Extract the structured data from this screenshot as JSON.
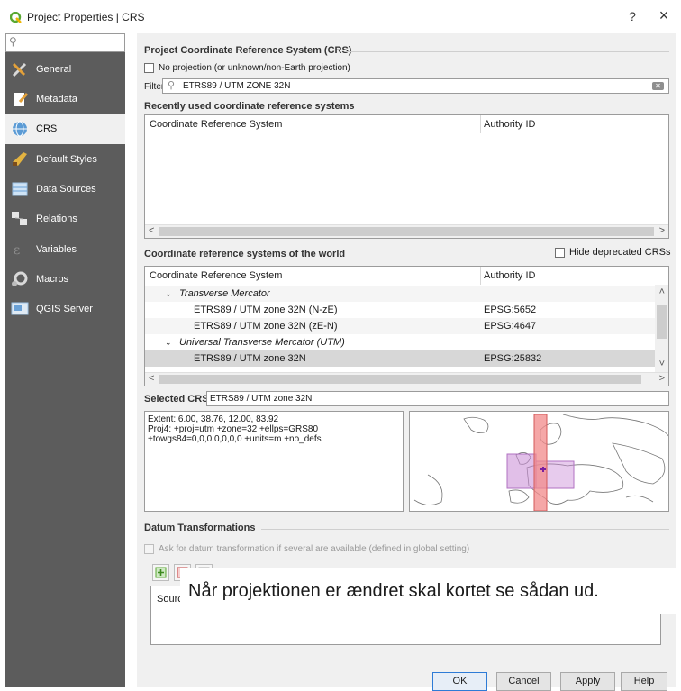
{
  "window": {
    "title": "Project Properties | CRS",
    "help_glyph": "?",
    "close_glyph": "×"
  },
  "sidebar": {
    "search_placeholder": "",
    "items": [
      {
        "label": "General",
        "icon": "tools-icon"
      },
      {
        "label": "Metadata",
        "icon": "metadata-icon"
      },
      {
        "label": "CRS",
        "icon": "globe-icon",
        "active": true
      },
      {
        "label": "Default Styles",
        "icon": "paintbrush-icon"
      },
      {
        "label": "Data Sources",
        "icon": "table-icon"
      },
      {
        "label": "Relations",
        "icon": "relations-icon"
      },
      {
        "label": "Variables",
        "icon": "variables-icon"
      },
      {
        "label": "Macros",
        "icon": "macros-icon"
      },
      {
        "label": "QGIS Server",
        "icon": "server-icon"
      }
    ]
  },
  "crs_panel": {
    "group_title": "Project Coordinate Reference System (CRS)",
    "no_projection_label": "No projection (or unknown/non-Earth projection)",
    "no_projection_checked": false,
    "filter_label": "Filter",
    "filter_value": "ETRS89 / UTM ZONE 32N",
    "recent_title": "Recently used coordinate reference systems",
    "recent_table": {
      "columns": [
        "Coordinate Reference System",
        "Authority ID"
      ],
      "rows": []
    },
    "world_title": "Coordinate reference systems of the world",
    "hide_deprecated_label": "Hide deprecated CRSs",
    "hide_deprecated_checked": false,
    "world_table": {
      "columns": [
        "Coordinate Reference System",
        "Authority ID"
      ],
      "rows": [
        {
          "name": "Transverse Mercator",
          "id": "",
          "group": true
        },
        {
          "name": "ETRS89 / UTM zone 32N (N-zE)",
          "id": "EPSG:5652"
        },
        {
          "name": "ETRS89 / UTM zone 32N (zE-N)",
          "id": "EPSG:4647"
        },
        {
          "name": "Universal Transverse Mercator (UTM)",
          "id": "",
          "group": true
        },
        {
          "name": "ETRS89 / UTM zone 32N",
          "id": "EPSG:25832",
          "selected": true
        }
      ]
    },
    "selected_crs_label": "Selected CRS",
    "selected_crs_value": "ETRS89 / UTM zone 32N",
    "extent_text": "Extent: 6.00, 38.76, 12.00, 83.92",
    "proj4_line1": "Proj4: +proj=utm +zone=32 +ellps=GRS80",
    "proj4_line2": "+towgs84=0,0,0,0,0,0,0 +units=m +no_defs"
  },
  "datum": {
    "group_title": "Datum Transformations",
    "ask_label": "Ask for datum transformation if several are available (defined in global setting)",
    "ask_checked": false,
    "source_header": "Sourc"
  },
  "caption": "Når projektionen er ændret skal kortet se sådan ud.",
  "buttons": {
    "ok": "OK",
    "cancel": "Cancel",
    "apply": "Apply",
    "help": "Help"
  },
  "colors": {
    "sidebar_bg": "#5c5c5c",
    "crs_band": "#f28a8a",
    "extent_box": "#c98bd6",
    "accent_default_button": "#2e7bd6"
  }
}
